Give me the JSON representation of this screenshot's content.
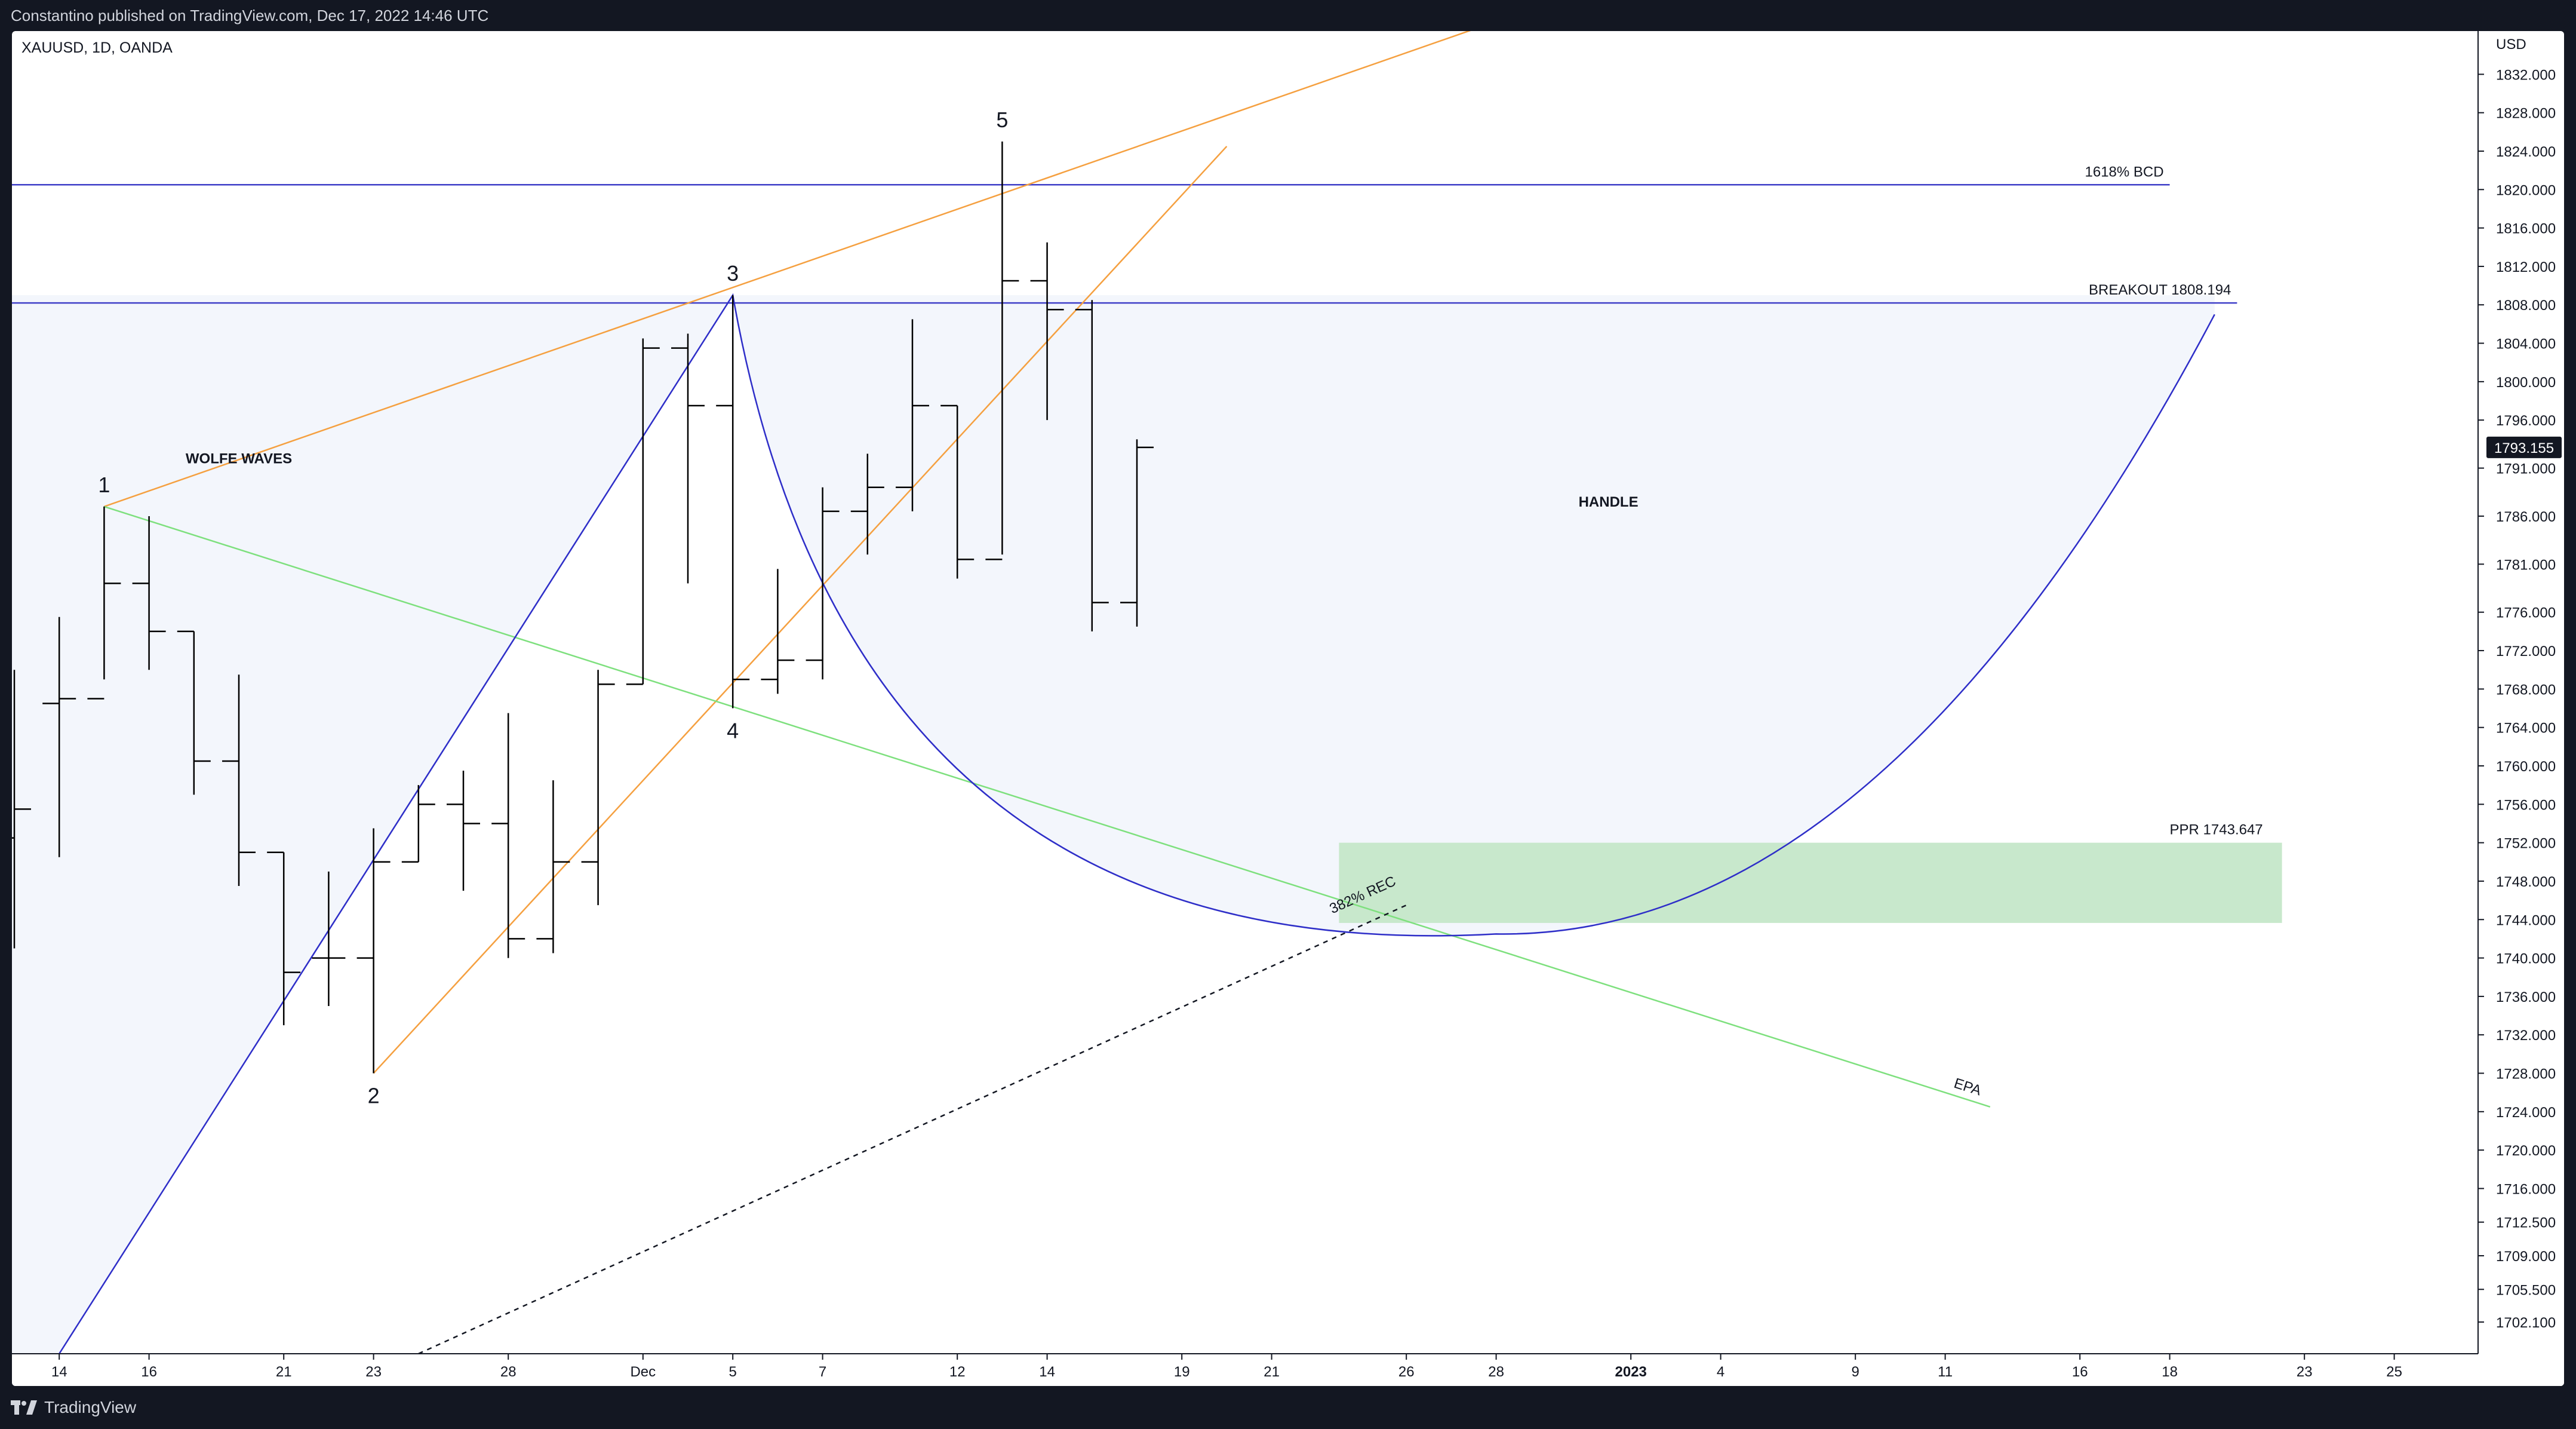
{
  "header": {
    "published": "Constantino published on TradingView.com, Dec 17, 2022 14:46 UTC"
  },
  "footer": {
    "brand": "TradingView",
    "logo_icon": "tradingview-logo-icon"
  },
  "colors": {
    "background": "#ffffff",
    "frame": "#131722",
    "bars": "#000000",
    "cup": "#2e2ec8",
    "blue_levels": "#3f3fc8",
    "wedge": "#f5a040",
    "epa_line": "#7ee07e",
    "ppr_zone": "#c8e8cc",
    "cup_fill": "#f3f6fc",
    "last_price_bg": "#131722"
  },
  "chart_data": {
    "type": "ohlc",
    "instrument": "XAUUSD, 1D, OANDA",
    "currency": "USD",
    "ylim": [
      1698.8,
      1836.5
    ],
    "y_ticks": [
      "1832.000",
      "1828.000",
      "1824.000",
      "1820.000",
      "1816.000",
      "1812.000",
      "1808.000",
      "1804.000",
      "1800.000",
      "1796.000",
      "1791.000",
      "1786.000",
      "1781.000",
      "1776.000",
      "1772.000",
      "1768.000",
      "1764.000",
      "1760.000",
      "1756.000",
      "1752.000",
      "1748.000",
      "1744.000",
      "1740.000",
      "1736.000",
      "1732.000",
      "1728.000",
      "1724.000",
      "1720.000",
      "1716.000",
      "1712.500",
      "1709.000",
      "1705.500",
      "1702.100"
    ],
    "x_ticks": [
      {
        "date": "2022-11-14",
        "label": "14",
        "bold": false
      },
      {
        "date": "2022-11-16",
        "label": "16",
        "bold": false
      },
      {
        "date": "2022-11-21",
        "label": "21",
        "bold": false
      },
      {
        "date": "2022-11-23",
        "label": "23",
        "bold": false
      },
      {
        "date": "2022-11-28",
        "label": "28",
        "bold": false
      },
      {
        "date": "2022-12-01",
        "label": "Dec",
        "bold": false
      },
      {
        "date": "2022-12-05",
        "label": "5",
        "bold": false
      },
      {
        "date": "2022-12-07",
        "label": "7",
        "bold": false
      },
      {
        "date": "2022-12-12",
        "label": "12",
        "bold": false
      },
      {
        "date": "2022-12-14",
        "label": "14",
        "bold": false
      },
      {
        "date": "2022-12-19",
        "label": "19",
        "bold": false
      },
      {
        "date": "2022-12-21",
        "label": "21",
        "bold": false
      },
      {
        "date": "2022-12-26",
        "label": "26",
        "bold": false
      },
      {
        "date": "2022-12-28",
        "label": "28",
        "bold": false
      },
      {
        "date": "2023-01-02",
        "label": "2023",
        "bold": true
      },
      {
        "date": "2023-01-04",
        "label": "4",
        "bold": false
      },
      {
        "date": "2023-01-09",
        "label": "9",
        "bold": false
      },
      {
        "date": "2023-01-11",
        "label": "11",
        "bold": false
      },
      {
        "date": "2023-01-16",
        "label": "16",
        "bold": false
      },
      {
        "date": "2023-01-18",
        "label": "18",
        "bold": false
      },
      {
        "date": "2023-01-23",
        "label": "23",
        "bold": false
      },
      {
        "date": "2023-01-25",
        "label": "25",
        "bold": false
      }
    ],
    "bars": [
      {
        "date": "2022-11-11",
        "open": 1752.5,
        "high": 1770.0,
        "low": 1741.0,
        "close": 1755.5
      },
      {
        "date": "2022-11-14",
        "open": 1766.5,
        "high": 1775.5,
        "low": 1750.5,
        "close": 1767.0
      },
      {
        "date": "2022-11-15",
        "open": 1767.0,
        "high": 1787.0,
        "low": 1769.0,
        "close": 1779.0
      },
      {
        "date": "2022-11-16",
        "open": 1779.0,
        "high": 1786.0,
        "low": 1770.0,
        "close": 1774.0
      },
      {
        "date": "2022-11-17",
        "open": 1774.0,
        "high": 1774.0,
        "low": 1757.0,
        "close": 1760.5
      },
      {
        "date": "2022-11-18",
        "open": 1760.5,
        "high": 1769.5,
        "low": 1747.5,
        "close": 1751.0
      },
      {
        "date": "2022-11-21",
        "open": 1751.0,
        "high": 1751.0,
        "low": 1733.0,
        "close": 1738.5
      },
      {
        "date": "2022-11-22",
        "open": 1740.0,
        "high": 1749.0,
        "low": 1735.0,
        "close": 1740.0
      },
      {
        "date": "2022-11-23",
        "open": 1740.0,
        "high": 1753.5,
        "low": 1728.0,
        "close": 1750.0
      },
      {
        "date": "2022-11-24",
        "open": 1750.0,
        "high": 1758.0,
        "low": 1750.0,
        "close": 1756.0
      },
      {
        "date": "2022-11-25",
        "open": 1756.0,
        "high": 1759.5,
        "low": 1747.0,
        "close": 1754.0
      },
      {
        "date": "2022-11-28",
        "open": 1754.0,
        "high": 1765.5,
        "low": 1740.0,
        "close": 1742.0
      },
      {
        "date": "2022-11-29",
        "open": 1742.0,
        "high": 1758.5,
        "low": 1740.5,
        "close": 1750.0
      },
      {
        "date": "2022-11-30",
        "open": 1750.0,
        "high": 1770.0,
        "low": 1745.5,
        "close": 1768.5
      },
      {
        "date": "2022-12-01",
        "open": 1768.5,
        "high": 1804.5,
        "low": 1768.5,
        "close": 1803.5
      },
      {
        "date": "2022-12-02",
        "open": 1803.5,
        "high": 1805.0,
        "low": 1779.0,
        "close": 1797.5
      },
      {
        "date": "2022-12-05",
        "open": 1797.5,
        "high": 1809.0,
        "low": 1766.0,
        "close": 1769.0
      },
      {
        "date": "2022-12-06",
        "open": 1769.0,
        "high": 1780.5,
        "low": 1767.5,
        "close": 1771.0
      },
      {
        "date": "2022-12-07",
        "open": 1771.0,
        "high": 1789.0,
        "low": 1769.0,
        "close": 1786.5
      },
      {
        "date": "2022-12-08",
        "open": 1786.5,
        "high": 1792.5,
        "low": 1782.0,
        "close": 1789.0
      },
      {
        "date": "2022-12-09",
        "open": 1789.0,
        "high": 1806.5,
        "low": 1786.5,
        "close": 1797.5
      },
      {
        "date": "2022-12-12",
        "open": 1797.5,
        "high": 1797.5,
        "low": 1779.5,
        "close": 1781.5
      },
      {
        "date": "2022-12-13",
        "open": 1781.5,
        "high": 1825.0,
        "low": 1782.0,
        "close": 1810.5
      },
      {
        "date": "2022-12-14",
        "open": 1810.5,
        "high": 1814.5,
        "low": 1796.0,
        "close": 1807.5
      },
      {
        "date": "2022-12-15",
        "open": 1807.5,
        "high": 1808.5,
        "low": 1774.0,
        "close": 1777.0
      },
      {
        "date": "2022-12-16",
        "open": 1777.0,
        "high": 1794.0,
        "low": 1774.5,
        "close": 1793.155
      }
    ],
    "last_price": "1793.155",
    "horizontal_levels": [
      {
        "label": "1618% BCD",
        "price": 1820.5,
        "x_start": "2022-11-11",
        "x_end": "2023-01-18"
      },
      {
        "label": "BREAKOUT 1808.194",
        "price": 1808.194,
        "x_start": "2022-11-11",
        "x_end": "2023-01-22"
      }
    ],
    "ppr_zone": {
      "label": "PPR 1743.647",
      "top": 1752.0,
      "bottom": 1743.647,
      "x_start": "2022-12-25",
      "x_end": "2023-01-21"
    },
    "wolfe_points": [
      {
        "label": "1",
        "date": "2022-11-15",
        "price": 1787.0
      },
      {
        "label": "2",
        "date": "2022-11-23",
        "price": 1728.0
      },
      {
        "label": "3",
        "date": "2022-12-05",
        "price": 1809.0
      },
      {
        "label": "4",
        "date": "2022-12-05",
        "price": 1766.0
      },
      {
        "label": "5",
        "date": "2022-12-13",
        "price": 1825.0
      }
    ],
    "wedge_upper": {
      "from": {
        "date": "2022-11-15",
        "price": 1787.0
      },
      "to": {
        "date": "2022-12-28",
        "price": 1837.5
      }
    },
    "wedge_lower": {
      "from": {
        "date": "2022-11-23",
        "price": 1728.0
      },
      "to": {
        "date": "2022-12-20",
        "price": 1824.5
      }
    },
    "epa_line": {
      "label": "EPA",
      "from": {
        "date": "2022-11-15",
        "price": 1787.0
      },
      "to": {
        "date": "2023-01-12",
        "price": 1724.5
      }
    },
    "rec_line": {
      "label": "382% REC",
      "from": {
        "date": "2022-11-24",
        "price": 1698.8
      },
      "to": {
        "date": "2022-12-26",
        "price": 1745.5
      }
    },
    "cup": {
      "rim_left": {
        "date": "2022-12-05",
        "price": 1809.0
      },
      "bottom": {
        "date": "2022-12-28",
        "price": 1742.5
      },
      "rim_right": {
        "date": "2023-01-19",
        "price": 1807.0
      },
      "left_arc_start": {
        "date": "2022-11-14",
        "price": 1698.8
      }
    },
    "annotations": [
      {
        "text": "WOLFE WAVES",
        "date": "2022-11-18",
        "price": 1791.5
      },
      {
        "text": "HANDLE",
        "date": "2022-12-31",
        "price": 1787.0
      }
    ]
  }
}
